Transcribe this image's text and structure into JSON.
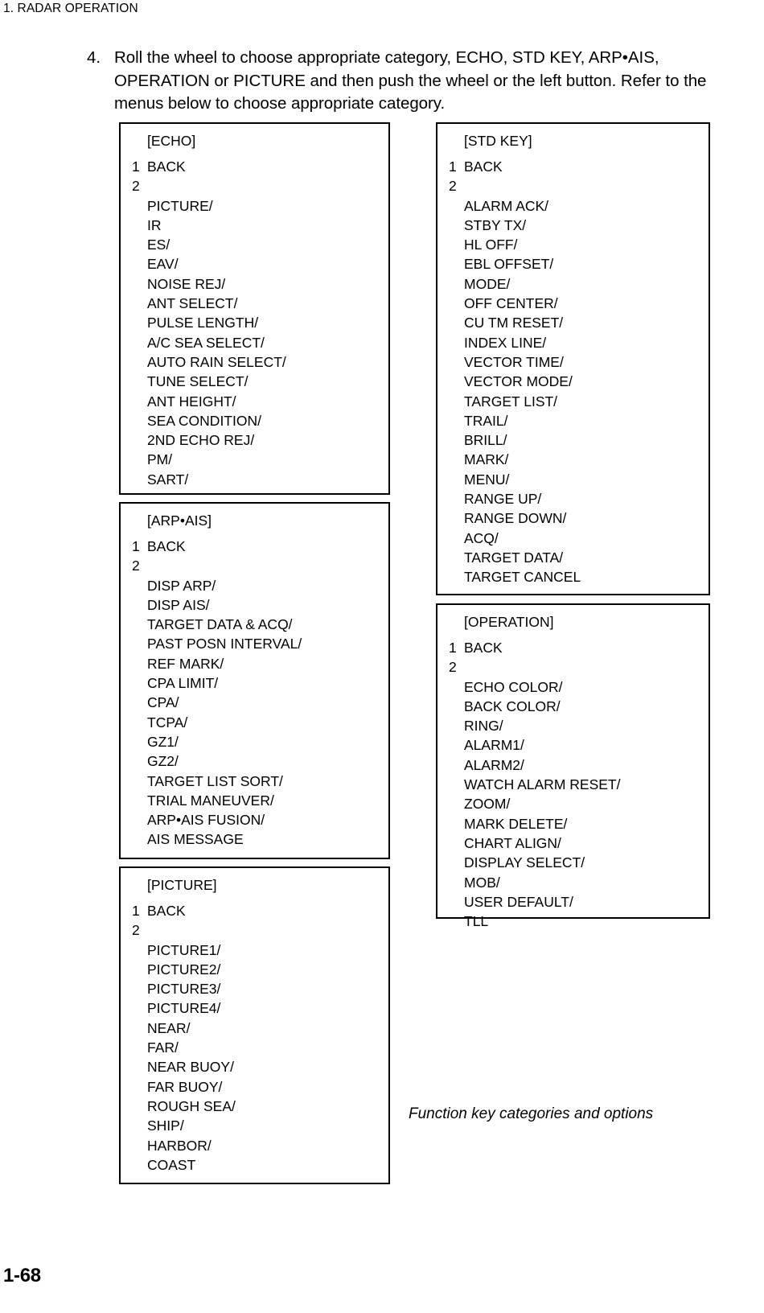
{
  "header": {
    "chapter_title": "1. RADAR OPERATION"
  },
  "step": {
    "number": "4.",
    "text": "Roll the wheel to choose appropriate category, ECHO, STD KEY, ARP•AIS, OPERATION or PICTURE and then push the wheel or the left button. Refer to the menus below to choose appropriate category."
  },
  "menus": [
    {
      "id": "echo",
      "title": "[ECHO]",
      "rows": [
        {
          "index": "1",
          "label": "BACK"
        },
        {
          "index": "2",
          "label": ""
        }
      ],
      "options": [
        "PICTURE/",
        "IR",
        "ES/",
        "EAV/",
        "NOISE REJ/",
        "ANT SELECT/",
        "PULSE LENGTH/",
        "A/C SEA SELECT/",
        "AUTO RAIN SELECT/",
        "TUNE SELECT/",
        "ANT HEIGHT/",
        "SEA CONDITION/",
        "2ND ECHO REJ/",
        "PM/",
        "SART/"
      ]
    },
    {
      "id": "arpais",
      "title": "[ARP•AIS]",
      "rows": [
        {
          "index": "1",
          "label": "BACK"
        },
        {
          "index": "2",
          "label": ""
        }
      ],
      "options": [
        "DISP ARP/",
        "DISP AIS/",
        "TARGET DATA & ACQ/",
        "PAST POSN INTERVAL/",
        "REF MARK/",
        "CPA LIMIT/",
        "CPA/",
        "TCPA/",
        "GZ1/",
        "GZ2/",
        "TARGET LIST SORT/",
        "TRIAL MANEUVER/",
        "ARP•AIS FUSION/",
        "AIS MESSAGE"
      ]
    },
    {
      "id": "picture",
      "title": "[PICTURE]",
      "rows": [
        {
          "index": "1",
          "label": "BACK"
        },
        {
          "index": "2",
          "label": ""
        }
      ],
      "options": [
        "PICTURE1/",
        "PICTURE2/",
        "PICTURE3/",
        "PICTURE4/",
        "NEAR/",
        "FAR/",
        "NEAR BUOY/",
        "FAR BUOY/",
        "ROUGH SEA/",
        "SHIP/",
        "HARBOR/",
        "COAST"
      ]
    },
    {
      "id": "stdkey",
      "title": "[STD KEY]",
      "rows": [
        {
          "index": "1",
          "label": "BACK"
        },
        {
          "index": "2",
          "label": ""
        }
      ],
      "options": [
        "ALARM ACK/",
        "STBY TX/",
        "HL OFF/",
        "EBL OFFSET/",
        "MODE/",
        "OFF CENTER/",
        "CU TM RESET/",
        "INDEX LINE/",
        "VECTOR TIME/",
        "VECTOR MODE/",
        "TARGET LIST/",
        "TRAIL/",
        "BRILL/",
        "MARK/",
        "MENU/",
        "RANGE UP/",
        "RANGE DOWN/",
        "ACQ/",
        "TARGET DATA/",
        "TARGET CANCEL"
      ]
    },
    {
      "id": "operation",
      "title": "[OPERATION]",
      "rows": [
        {
          "index": "1",
          "label": "BACK"
        },
        {
          "index": "2",
          "label": ""
        }
      ],
      "options": [
        "ECHO COLOR/",
        "BACK COLOR/",
        "RING/",
        "ALARM1/",
        "ALARM2/",
        "WATCH ALARM RESET/",
        "ZOOM/",
        "MARK DELETE/",
        "CHART ALIGN/",
        "DISPLAY SELECT/",
        "MOB/",
        "USER DEFAULT/",
        "TLL"
      ]
    }
  ],
  "caption": "Function key categories and options",
  "footer": {
    "page_number": "1-68"
  }
}
